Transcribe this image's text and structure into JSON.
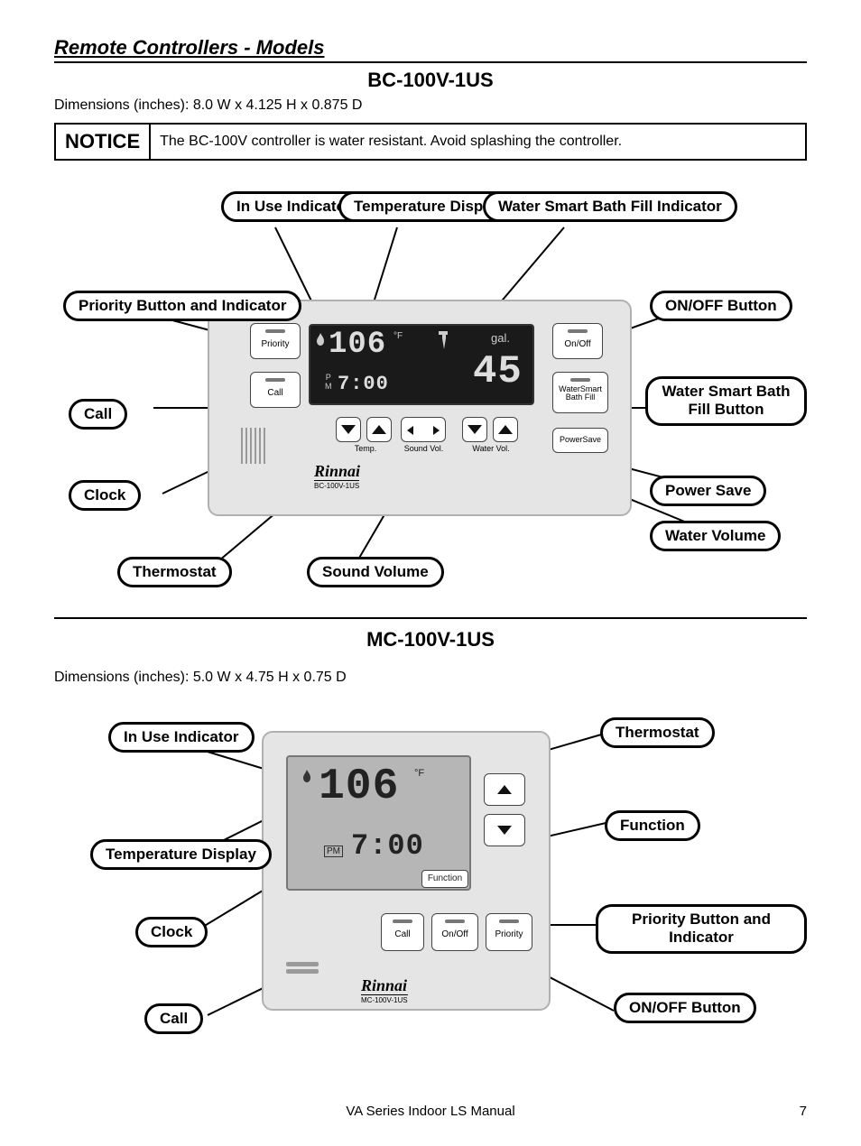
{
  "section_title": "Remote Controllers - Models",
  "bc": {
    "title": "BC-100V-1US",
    "dimensions": "Dimensions (inches):  8.0 W x 4.125 H x 0.875 D",
    "notice_label": "NOTICE",
    "notice_text": "The BC-100V controller is water resistant.  Avoid splashing the controller.",
    "callouts": {
      "in_use": "In Use Indicator",
      "temp_display": "Temperature Display",
      "water_smart_ind": "Water Smart Bath Fill Indicator",
      "priority": "Priority Button and Indicator",
      "onoff": "ON/OFF Button",
      "call": "Call",
      "water_smart_btn": "Water Smart Bath Fill Button",
      "clock": "Clock",
      "power_save": "Power Save",
      "thermostat": "Thermostat",
      "sound_vol": "Sound Volume",
      "water_vol": "Water Volume"
    },
    "device": {
      "priority_btn": "Priority",
      "onoff_btn": "On/Off",
      "call_btn": "Call",
      "watersmart_btn_l1": "WaterSmart",
      "watersmart_btn_l2": "Bath Fill",
      "powersave_btn": "PowerSave",
      "temp_label": "Temp.",
      "sound_label": "Sound Vol.",
      "water_label": "Water Vol.",
      "brand": "Rinnai",
      "model": "BC-100V-1US",
      "temp_value": "106",
      "temp_unit": "°F",
      "gal_label": "gal.",
      "gal_value": "45",
      "clock_pm": "P\nM",
      "clock_value": "7:00"
    }
  },
  "mc": {
    "title": "MC-100V-1US",
    "dimensions": "Dimensions (inches):  5.0 W x 4.75 H x 0.75 D",
    "callouts": {
      "in_use": "In Use Indicator",
      "thermostat": "Thermostat",
      "temp_display": "Temperature Display",
      "function": "Function",
      "clock": "Clock",
      "priority": "Priority Button and Indicator",
      "call": "Call",
      "onoff": "ON/OFF Button"
    },
    "device": {
      "function_btn": "Function",
      "call_btn": "Call",
      "onoff_btn": "On/Off",
      "priority_btn": "Priority",
      "brand": "Rinnai",
      "model": "MC-100V-1US",
      "temp_value": "106",
      "temp_unit": "°F",
      "clock_pm": "PM",
      "clock_value": "7:00"
    }
  },
  "footer": "VA Series Indoor LS Manual",
  "page": "7"
}
